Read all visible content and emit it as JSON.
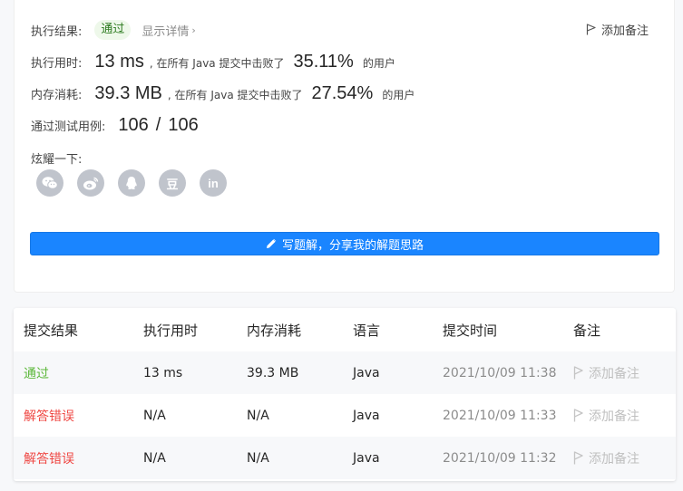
{
  "result": {
    "label": "执行结果:",
    "status": "通过",
    "detail": "显示详情",
    "detail_chevron": "›",
    "note": "添加备注"
  },
  "runtime": {
    "label": "执行用时:",
    "value": "13 ms",
    "prefix": ", 在所有 Java 提交中击败了",
    "percent": "35.11%",
    "suffix": "的用户"
  },
  "memory": {
    "label": "内存消耗:",
    "value": "39.3 MB",
    "prefix": ", 在所有 Java 提交中击败了",
    "percent": "27.54%",
    "suffix": "的用户"
  },
  "tests": {
    "label": "通过测试用例:",
    "passed": "106",
    "separator": "/",
    "total": "106"
  },
  "share": {
    "label": "炫耀一下:",
    "icons": [
      "wechat-icon",
      "weibo-icon",
      "qq-icon",
      "douban-icon",
      "linkedin-icon"
    ],
    "douban_glyph": "豆",
    "linkedin_glyph": "in"
  },
  "write_solution": {
    "label": "写题解，分享我的解题思路"
  },
  "table": {
    "headers": [
      "提交结果",
      "执行用时",
      "内存消耗",
      "语言",
      "提交时间",
      "备注"
    ],
    "rows": [
      {
        "result": "通过",
        "runtime": "13 ms",
        "memory": "39.3 MB",
        "language": "Java",
        "time": "2021/10/09 11:38",
        "note": "添加备注"
      },
      {
        "result": "解答错误",
        "runtime": "N/A",
        "memory": "N/A",
        "language": "Java",
        "time": "2021/10/09 11:33",
        "note": "添加备注"
      },
      {
        "result": "解答错误",
        "runtime": "N/A",
        "memory": "N/A",
        "language": "Java",
        "time": "2021/10/09 11:32",
        "note": "添加备注"
      }
    ]
  },
  "colors": {
    "primary": "#1a85ff",
    "success": "#5cb83a",
    "error": "#ef4743",
    "icon_gray": "#c0c4cc"
  }
}
